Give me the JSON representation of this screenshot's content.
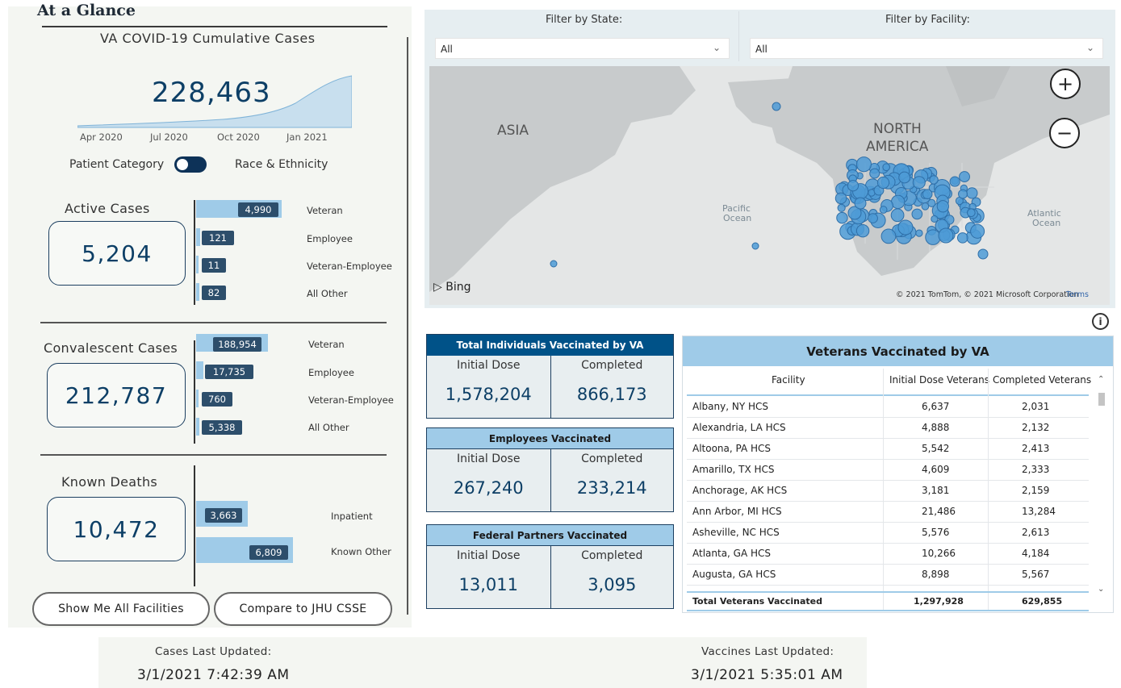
{
  "glance": {
    "title": "At a Glance",
    "cumulative_title": "VA COVID-19 Cumulative Cases",
    "cumulative_value": "228,463",
    "axis_labels": [
      "Apr 2020",
      "Jul 2020",
      "Oct 2020",
      "Jan 2021"
    ],
    "toggle_left": "Patient Category",
    "toggle_right": "Race & Ethnicity"
  },
  "active": {
    "title": "Active Cases",
    "total": "5,204",
    "rows": [
      {
        "label": "Veteran",
        "value": "4,990"
      },
      {
        "label": "Employee",
        "value": "121"
      },
      {
        "label": "Veteran-Employee",
        "value": "11"
      },
      {
        "label": "All Other",
        "value": "82"
      }
    ]
  },
  "convalescent": {
    "title": "Convalescent Cases",
    "total": "212,787",
    "rows": [
      {
        "label": "Veteran",
        "value": "188,954"
      },
      {
        "label": "Employee",
        "value": "17,735"
      },
      {
        "label": "Veteran-Employee",
        "value": "760"
      },
      {
        "label": "All Other",
        "value": "5,338"
      }
    ]
  },
  "deaths": {
    "title": "Known Deaths",
    "total": "10,472",
    "rows": [
      {
        "label": "Inpatient",
        "value": "3,663"
      },
      {
        "label": "Known Other",
        "value": "6,809"
      }
    ]
  },
  "buttons": {
    "all_facilities": "Show Me All Facilities",
    "compare": "Compare to JHU CSSE"
  },
  "filters": {
    "state_label": "Filter by State:",
    "state_value": "All",
    "facility_label": "Filter by Facility:",
    "facility_value": "All"
  },
  "map": {
    "label_asia": "ASIA",
    "label_na_1": "NORTH",
    "label_na_2": "AMERICA",
    "label_pacific_1": "Pacific",
    "label_pacific_2": "Ocean",
    "label_atlantic_1": "Atlantic",
    "label_atlantic_2": "Ocean",
    "bing": "Bing",
    "copyright": "© 2021 TomTom, © 2021 Microsoft Corporation",
    "terms": "Terms"
  },
  "vaccinations": {
    "total": {
      "title": "Total Individuals Vaccinated by VA",
      "initial_label": "Initial Dose",
      "initial": "1,578,204",
      "completed_label": "Completed",
      "completed": "866,173"
    },
    "employees": {
      "title": "Employees Vaccinated",
      "initial_label": "Initial Dose",
      "initial": "267,240",
      "completed_label": "Completed",
      "completed": "233,214"
    },
    "federal": {
      "title": "Federal Partners Vaccinated",
      "initial_label": "Initial Dose",
      "initial": "13,011",
      "completed_label": "Completed",
      "completed": "3,095"
    }
  },
  "table": {
    "title": "Veterans Vaccinated by VA",
    "columns": [
      "Facility",
      "Initial Dose Veterans",
      "Completed Veterans"
    ],
    "rows": [
      [
        "Albany, NY HCS",
        "6,637",
        "2,031"
      ],
      [
        "Alexandria, LA HCS",
        "4,888",
        "2,132"
      ],
      [
        "Altoona, PA HCS",
        "5,542",
        "2,413"
      ],
      [
        "Amarillo, TX HCS",
        "4,609",
        "2,333"
      ],
      [
        "Anchorage, AK HCS",
        "3,181",
        "2,159"
      ],
      [
        "Ann Arbor, MI HCS",
        "21,486",
        "13,284"
      ],
      [
        "Asheville, NC HCS",
        "5,576",
        "2,613"
      ],
      [
        "Atlanta, GA HCS",
        "10,266",
        "4,184"
      ],
      [
        "Augusta, GA HCS",
        "8,898",
        "5,567"
      ]
    ],
    "total": [
      "Total Veterans Vaccinated",
      "1,297,928",
      "629,855"
    ]
  },
  "footer": {
    "cases_label": "Cases Last Updated:",
    "cases_value": "3/1/2021 7:42:39 AM",
    "vaccines_label": "Vaccines Last Updated:",
    "vaccines_value": "3/1/2021 5:35:01 AM"
  },
  "colors": {
    "navy": "#0d3f66",
    "bar_light": "#9fcbe8",
    "badge": "#2d4e6b",
    "card_header_dark": "#005288",
    "map_dot": "#4d9bd6"
  }
}
